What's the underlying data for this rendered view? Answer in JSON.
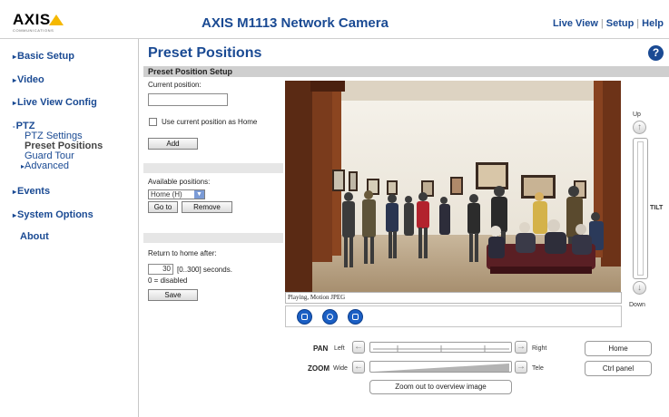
{
  "header": {
    "logo": "AXIS",
    "logo_sub": "COMMUNICATIONS",
    "product_title": "AXIS M1113 Network Camera",
    "nav": {
      "live_view": "Live View",
      "setup": "Setup",
      "help": "Help"
    }
  },
  "sidebar": {
    "basic_setup": "Basic Setup",
    "video": "Video",
    "live_view_config": "Live View Config",
    "ptz": "PTZ",
    "ptz_items": [
      "PTZ Settings",
      "Preset Positions",
      "Guard Tour",
      "Advanced"
    ],
    "events": "Events",
    "system_options": "System Options",
    "about": "About"
  },
  "main": {
    "page_title": "Preset Positions",
    "section_title": "Preset Position Setup",
    "current_position_label": "Current position:",
    "current_position_value": "",
    "use_as_home_label": "Use current position as Home",
    "add_button": "Add",
    "available_positions_label": "Available positions:",
    "available_selected": "Home (H)",
    "goto_button": "Go to",
    "remove_button": "Remove",
    "return_home_label": "Return to home after:",
    "return_home_value": "30",
    "return_home_units": "[0..300] seconds.",
    "disabled_note": "0 = disabled",
    "save_button": "Save"
  },
  "video": {
    "status": "Playing, Motion JPEG",
    "tilt_up": "Up",
    "tilt_down": "Down",
    "tilt_label": "TILT",
    "pan_label": "PAN",
    "pan_left": "Left",
    "pan_right": "Right",
    "zoom_label": "ZOOM",
    "zoom_wide": "Wide",
    "zoom_tele": "Tele",
    "home_button": "Home",
    "ctrl_panel_button": "Ctrl panel",
    "zoom_out_button": "Zoom out to overview image"
  },
  "colors": {
    "brand": "#1a4a93",
    "accent": "#f5b800",
    "button_blue": "#1b5fc4"
  }
}
